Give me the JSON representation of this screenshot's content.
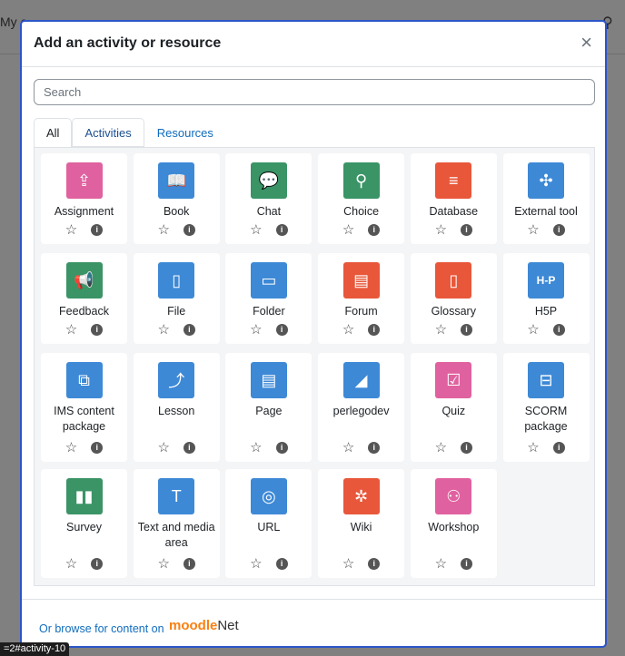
{
  "background": {
    "nav_text": "My c"
  },
  "modal": {
    "title": "Add an activity or resource",
    "close": "×",
    "search_placeholder": "Search",
    "tabs": [
      {
        "label": "All",
        "active": true
      },
      {
        "label": "Activities"
      },
      {
        "label": "Resources"
      }
    ],
    "items": [
      {
        "label": "Assignment",
        "color": "#e0619f",
        "icon": "assignment-icon",
        "glyph": "⇪"
      },
      {
        "label": "Book",
        "color": "#3d89d6",
        "icon": "book-icon",
        "glyph": "📖"
      },
      {
        "label": "Chat",
        "color": "#3a9466",
        "icon": "chat-icon",
        "glyph": "💬"
      },
      {
        "label": "Choice",
        "color": "#3a9466",
        "icon": "choice-icon",
        "glyph": "⚲"
      },
      {
        "label": "Database",
        "color": "#e8573a",
        "icon": "database-icon",
        "glyph": "≡"
      },
      {
        "label": "External tool",
        "color": "#3d89d6",
        "icon": "puzzle-icon",
        "glyph": "✣"
      },
      {
        "label": "Feedback",
        "color": "#3a9466",
        "icon": "megaphone-icon",
        "glyph": "📢"
      },
      {
        "label": "File",
        "color": "#3d89d6",
        "icon": "file-icon",
        "glyph": "▯"
      },
      {
        "label": "Folder",
        "color": "#3d89d6",
        "icon": "folder-icon",
        "glyph": "▭"
      },
      {
        "label": "Forum",
        "color": "#e8573a",
        "icon": "forum-icon",
        "glyph": "▤"
      },
      {
        "label": "Glossary",
        "color": "#e8573a",
        "icon": "glossary-icon",
        "glyph": "▯"
      },
      {
        "label": "H5P",
        "color": "#3d89d6",
        "icon": "h5p-icon",
        "glyph": "H-P"
      },
      {
        "label": "IMS content package",
        "color": "#3d89d6",
        "icon": "package-icon",
        "glyph": "⧉"
      },
      {
        "label": "Lesson",
        "color": "#3d89d6",
        "icon": "lesson-icon",
        "glyph": "⤴"
      },
      {
        "label": "Page",
        "color": "#3d89d6",
        "icon": "page-icon",
        "glyph": "▤"
      },
      {
        "label": "perlegodev",
        "color": "#3d89d6",
        "icon": "perlego-icon",
        "glyph": "◢"
      },
      {
        "label": "Quiz",
        "color": "#e0619f",
        "icon": "quiz-icon",
        "glyph": "☑"
      },
      {
        "label": "SCORM package",
        "color": "#3d89d6",
        "icon": "scorm-icon",
        "glyph": "⊟"
      },
      {
        "label": "Survey",
        "color": "#3a9466",
        "icon": "chart-icon",
        "glyph": "▮▮"
      },
      {
        "label": "Text and media area",
        "color": "#3d89d6",
        "icon": "text-media-icon",
        "glyph": "T"
      },
      {
        "label": "URL",
        "color": "#3d89d6",
        "icon": "globe-icon",
        "glyph": "◎"
      },
      {
        "label": "Wiki",
        "color": "#e8573a",
        "icon": "wiki-icon",
        "glyph": "✲"
      },
      {
        "label": "Workshop",
        "color": "#e0619f",
        "icon": "workshop-icon",
        "glyph": "⚇"
      }
    ],
    "star": "☆",
    "info": "i",
    "footer": {
      "browse": "Or browse for content on",
      "logo_a": "moodle",
      "logo_b": "Net"
    }
  },
  "status_url": "=2#activity-10"
}
